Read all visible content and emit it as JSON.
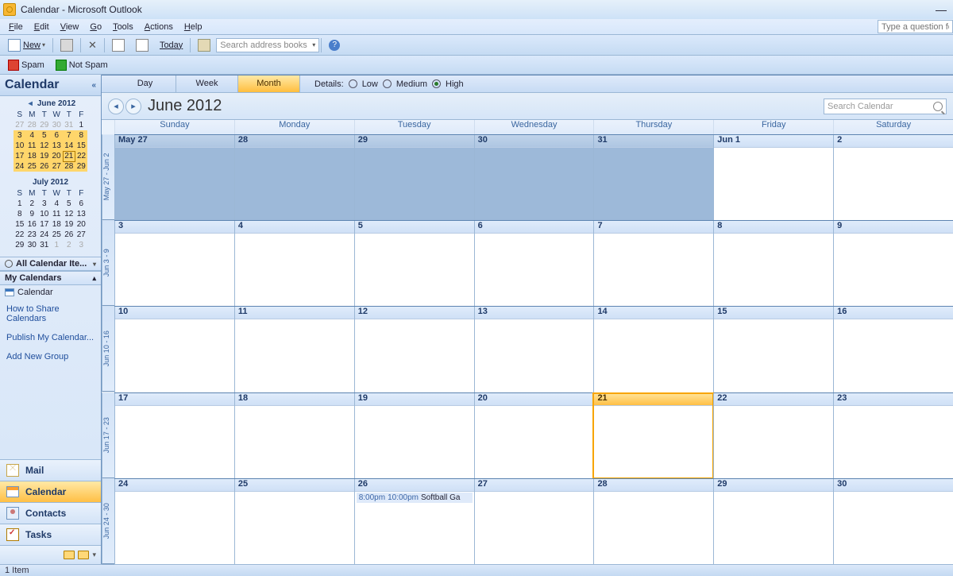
{
  "title": "Calendar - Microsoft Outlook",
  "menu": [
    "File",
    "Edit",
    "View",
    "Go",
    "Tools",
    "Actions",
    "Help"
  ],
  "help_placeholder": "Type a question for",
  "toolbar": {
    "new": "New",
    "today": "Today",
    "search_placeholder": "Search address books"
  },
  "spam": {
    "spam": "Spam",
    "notspam": "Not Spam"
  },
  "nav": {
    "title": "Calendar",
    "collapse": "«",
    "mini1": {
      "label": "June 2012",
      "dow": [
        "S",
        "M",
        "T",
        "W",
        "T",
        "F"
      ],
      "rows": [
        {
          "hl": false,
          "cells": [
            {
              "d": "27",
              "p": true
            },
            {
              "d": "28",
              "p": true
            },
            {
              "d": "29",
              "p": true
            },
            {
              "d": "30",
              "p": true
            },
            {
              "d": "31",
              "p": true
            },
            {
              "d": "1"
            }
          ]
        },
        {
          "hl": true,
          "cells": [
            {
              "d": "3"
            },
            {
              "d": "4"
            },
            {
              "d": "5"
            },
            {
              "d": "6"
            },
            {
              "d": "7"
            },
            {
              "d": "8"
            }
          ]
        },
        {
          "hl": true,
          "cells": [
            {
              "d": "10"
            },
            {
              "d": "11"
            },
            {
              "d": "12"
            },
            {
              "d": "13"
            },
            {
              "d": "14"
            },
            {
              "d": "15"
            }
          ]
        },
        {
          "hl": true,
          "cells": [
            {
              "d": "17"
            },
            {
              "d": "18"
            },
            {
              "d": "19"
            },
            {
              "d": "20"
            },
            {
              "d": "21",
              "today": true
            },
            {
              "d": "22"
            }
          ]
        },
        {
          "hl": true,
          "cells": [
            {
              "d": "24"
            },
            {
              "d": "25"
            },
            {
              "d": "26"
            },
            {
              "d": "27"
            },
            {
              "d": "28"
            },
            {
              "d": "29"
            }
          ]
        }
      ]
    },
    "mini2": {
      "label": "July 2012",
      "dow": [
        "S",
        "M",
        "T",
        "W",
        "T",
        "F"
      ],
      "rows": [
        {
          "cells": [
            {
              "d": "1"
            },
            {
              "d": "2"
            },
            {
              "d": "3"
            },
            {
              "d": "4"
            },
            {
              "d": "5"
            },
            {
              "d": "6"
            }
          ]
        },
        {
          "cells": [
            {
              "d": "8"
            },
            {
              "d": "9"
            },
            {
              "d": "10"
            },
            {
              "d": "11"
            },
            {
              "d": "12"
            },
            {
              "d": "13"
            }
          ]
        },
        {
          "cells": [
            {
              "d": "15"
            },
            {
              "d": "16"
            },
            {
              "d": "17"
            },
            {
              "d": "18"
            },
            {
              "d": "19"
            },
            {
              "d": "20"
            }
          ]
        },
        {
          "cells": [
            {
              "d": "22"
            },
            {
              "d": "23"
            },
            {
              "d": "24"
            },
            {
              "d": "25"
            },
            {
              "d": "26"
            },
            {
              "d": "27"
            }
          ]
        },
        {
          "cells": [
            {
              "d": "29"
            },
            {
              "d": "30"
            },
            {
              "d": "31"
            },
            {
              "d": "1",
              "p": true
            },
            {
              "d": "2",
              "p": true
            },
            {
              "d": "3",
              "p": true
            }
          ]
        }
      ]
    },
    "all_items": "All Calendar Ite...",
    "my_cals": "My Calendars",
    "cal_item": "Calendar",
    "links": [
      "How to Share Calendars",
      "Publish My Calendar...",
      "Add New Group"
    ],
    "buttons": [
      "Mail",
      "Calendar",
      "Contacts",
      "Tasks"
    ]
  },
  "view": {
    "tabs": [
      "Day",
      "Week",
      "Month"
    ],
    "selected_idx": 2,
    "details_label": "Details:",
    "details_options": [
      "Low",
      "Medium",
      "High"
    ],
    "details_selected": 2
  },
  "header": {
    "month": "June 2012",
    "search_placeholder": "Search Calendar"
  },
  "grid": {
    "day_names": [
      "Sunday",
      "Monday",
      "Tuesday",
      "Wednesday",
      "Thursday",
      "Friday",
      "Saturday"
    ],
    "weeks": [
      {
        "label": "May 27 - Jun 2",
        "cells": [
          {
            "d": "May 27",
            "prev": true
          },
          {
            "d": "28",
            "prev": true
          },
          {
            "d": "29",
            "prev": true
          },
          {
            "d": "30",
            "prev": true
          },
          {
            "d": "31",
            "prev": true
          },
          {
            "d": "Jun 1"
          },
          {
            "d": "2"
          }
        ]
      },
      {
        "label": "Jun 3 - 9",
        "cells": [
          {
            "d": "3"
          },
          {
            "d": "4"
          },
          {
            "d": "5"
          },
          {
            "d": "6"
          },
          {
            "d": "7"
          },
          {
            "d": "8"
          },
          {
            "d": "9"
          }
        ]
      },
      {
        "label": "Jun 10 - 16",
        "cells": [
          {
            "d": "10"
          },
          {
            "d": "11"
          },
          {
            "d": "12"
          },
          {
            "d": "13"
          },
          {
            "d": "14"
          },
          {
            "d": "15"
          },
          {
            "d": "16"
          }
        ]
      },
      {
        "label": "Jun 17 - 23",
        "cells": [
          {
            "d": "17"
          },
          {
            "d": "18"
          },
          {
            "d": "19"
          },
          {
            "d": "20"
          },
          {
            "d": "21",
            "today": true
          },
          {
            "d": "22"
          },
          {
            "d": "23"
          }
        ]
      },
      {
        "label": "Jun 24 - 30",
        "cells": [
          {
            "d": "24"
          },
          {
            "d": "25"
          },
          {
            "d": "26",
            "event": {
              "start": "8:00pm",
              "end": "10:00pm",
              "title": "Softball Ga"
            }
          },
          {
            "d": "27"
          },
          {
            "d": "28"
          },
          {
            "d": "29"
          },
          {
            "d": "30"
          }
        ]
      }
    ]
  },
  "status": "1 Item"
}
